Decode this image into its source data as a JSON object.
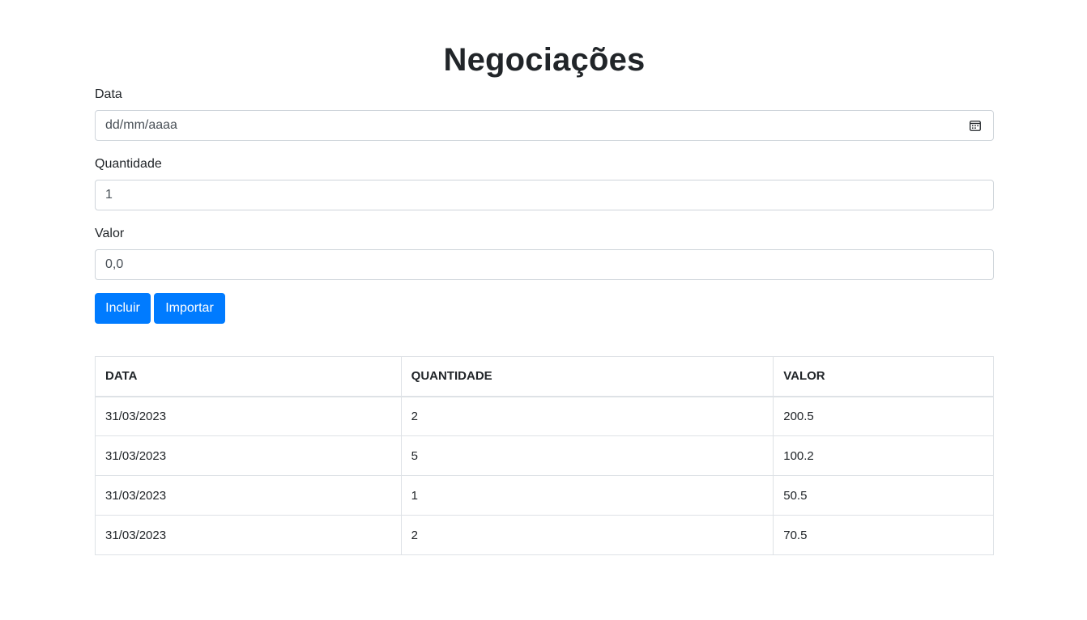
{
  "page": {
    "title": "Negociações"
  },
  "form": {
    "data": {
      "label": "Data",
      "placeholder": "dd/mm/aaaa",
      "icon": "calendar-icon"
    },
    "quantidade": {
      "label": "Quantidade",
      "value": "1"
    },
    "valor": {
      "label": "Valor",
      "value": "0,0"
    },
    "buttons": {
      "incluir": "Incluir",
      "importar": "Importar"
    }
  },
  "table": {
    "headers": [
      "DATA",
      "QUANTIDADE",
      "VALOR"
    ],
    "rows": [
      [
        "31/03/2023",
        "2",
        "200.5"
      ],
      [
        "31/03/2023",
        "5",
        "100.2"
      ],
      [
        "31/03/2023",
        "1",
        "50.5"
      ],
      [
        "31/03/2023",
        "2",
        "70.5"
      ]
    ]
  },
  "colors": {
    "primary": "#007bff",
    "text": "#212529",
    "border": "#dee2e6",
    "input_border": "#ced4da"
  }
}
